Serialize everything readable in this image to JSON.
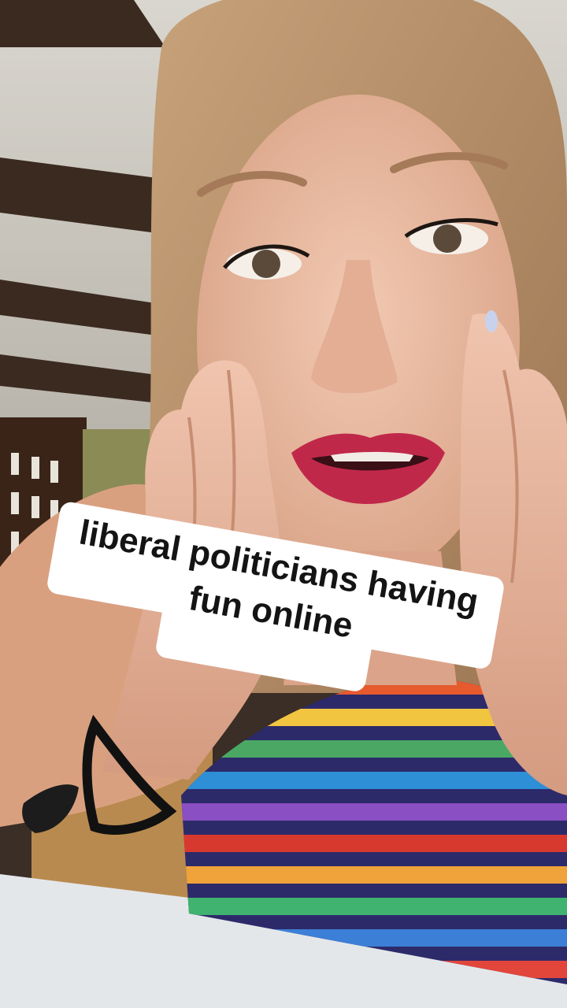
{
  "scene": {
    "description_icons": [
      "woman-face",
      "hands-cupped",
      "rainbow-striped-top",
      "wrist-bracelet"
    ]
  },
  "caption": {
    "lines": [
      "liberal politicians having",
      "fun online"
    ],
    "line1": "liberal politicians having",
    "line2": "fun online"
  },
  "colors": {
    "caption_bg": "#ffffff",
    "caption_text": "#141414",
    "lips": "#c0284a",
    "skin": "#e9b9a0"
  }
}
